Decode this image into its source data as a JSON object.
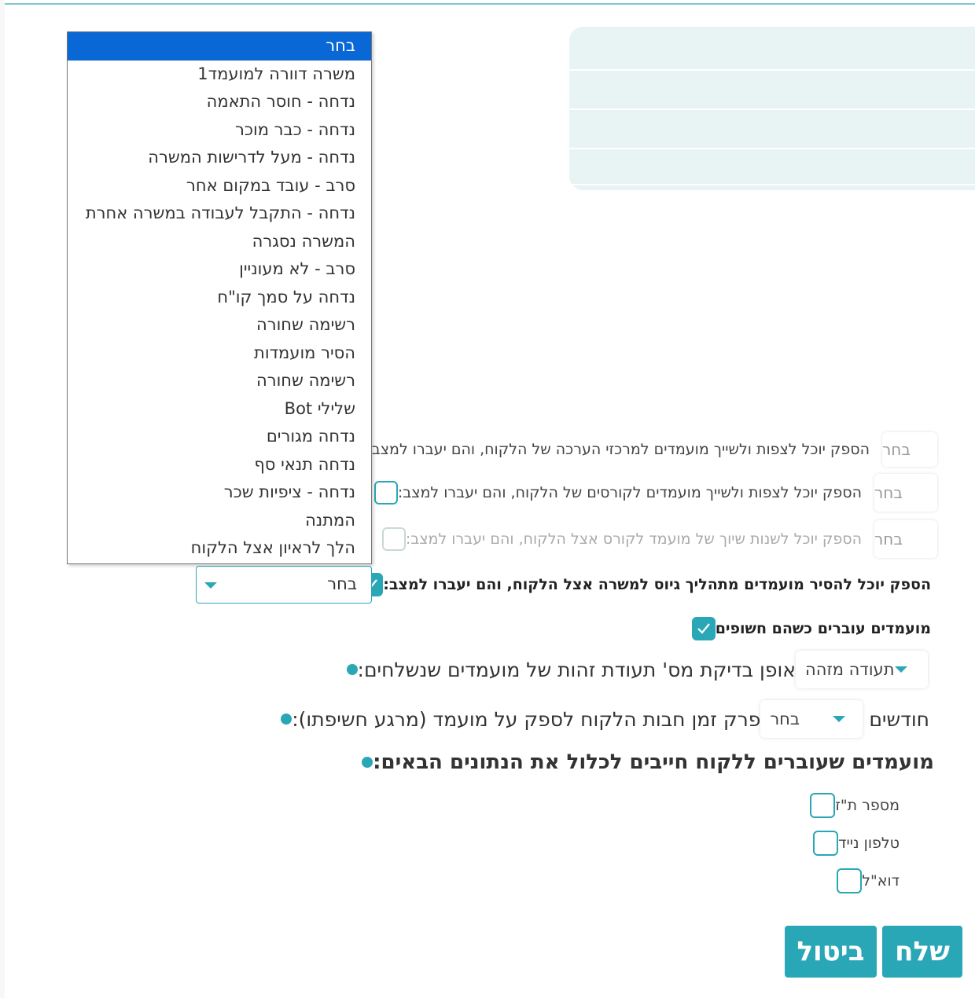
{
  "dropdown": {
    "options": [
      "בחר",
      "משרה דוורה למועמד1",
      "נדחה - חוסר התאמה",
      "נדחה - כבר מוכר",
      "נדחה - מעל לדרישות המשרה",
      "סרב - עובד במקום אחר",
      "נדחה - התקבל לעבודה במשרה אחרת",
      "המשרה נסגרה",
      "סרב - לא מעוניין",
      "נדחה על סמך קו\"ח",
      "רשימה שחורה",
      "הסיר מועמדות",
      "רשימה שחורה",
      "שלילי Bot",
      "נדחה מגורים",
      "נדחה תנאי סף",
      "נדחה - ציפיות שכר",
      "המתנה",
      "הלך לראיון אצל הלקוח"
    ]
  },
  "permissions": [
    {
      "text": "הספק יוכל לצפות ולשייך מועמדים למרכזי הערכה של הלקוח, והם יעברו למצב:",
      "select_value": "בחר",
      "checked": false,
      "disabled": false
    },
    {
      "text": "הספק יוכל לצפות ולשייך מועמדים לקורסים של הלקוח, והם יעברו למצב:",
      "select_value": "בחר",
      "checked": false,
      "disabled": false
    },
    {
      "text": "הספק יוכל לשנות שיוך של מועמד לקורס אצל הלקוח, והם יעברו למצב:",
      "select_value": "בחר",
      "checked": false,
      "disabled": true
    },
    {
      "text": "הספק יוכל להסיר מועמדים מתהליך גיוס למשרה אצל הלקוח, והם יעברו למצב:",
      "select_value": "בחר",
      "checked": true,
      "disabled": false
    },
    {
      "text": "מועמדים עוברים כשהם חשופים",
      "checked": true
    }
  ],
  "id_check": {
    "label": "אופן בדיקת מס' תעודת זהות של מועמדים שנשלחים:",
    "value": "תעודה מזהה"
  },
  "ownership": {
    "label": "פרק זמן חבות הלקוח לספק על מועמד (מרגע חשיפתו):",
    "value": "בחר",
    "unit": "חודשים"
  },
  "required_fields": {
    "label": "מועמדים שעוברים ללקוח חייבים לכלול את הנתונים הבאים:",
    "items": [
      "מספר ת\"ז",
      "טלפון נייד",
      "דוא\"ל"
    ]
  },
  "buttons": {
    "send": "שלח",
    "cancel": "ביטול"
  },
  "colors": {
    "accent": "#2aa7b6",
    "selected": "#0a67d6",
    "panel": "#e8f3f4"
  }
}
